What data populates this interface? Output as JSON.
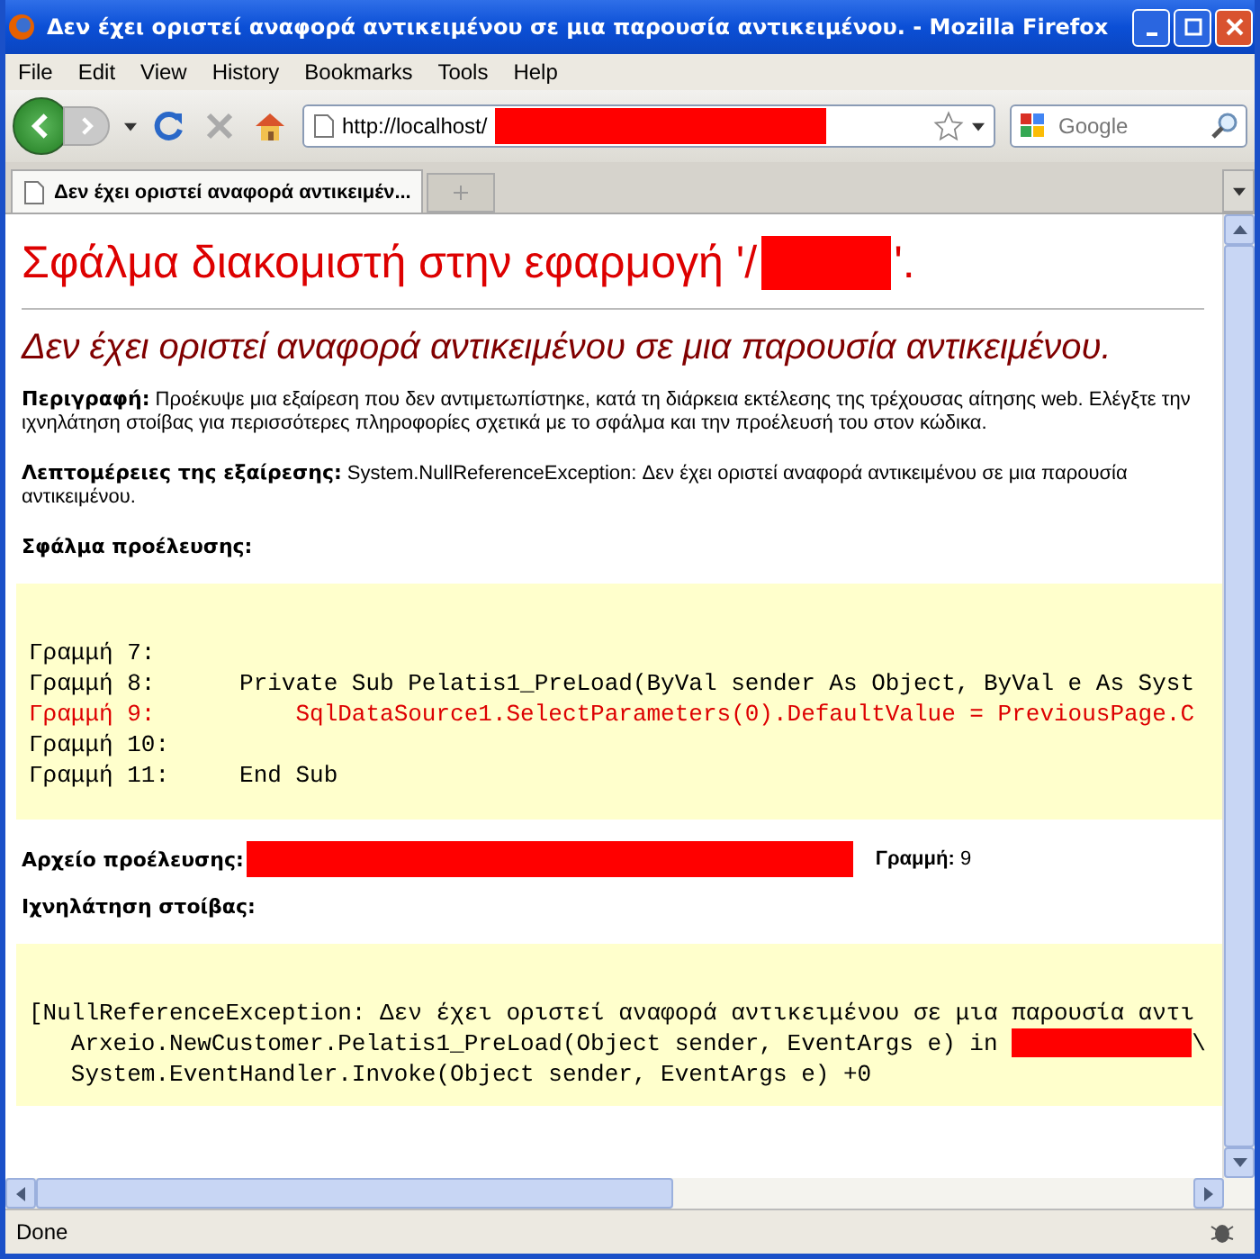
{
  "window": {
    "title": "Δεν έχει οριστεί αναφορά αντικειμένου σε μια παρουσία αντικειμένου. - Mozilla Firefox"
  },
  "menu": [
    "File",
    "Edit",
    "View",
    "History",
    "Bookmarks",
    "Tools",
    "Help"
  ],
  "toolbar": {
    "url": "http://localhost/",
    "search_placeholder": "Google"
  },
  "tabs": [
    {
      "label": "Δεν έχει οριστεί αναφορά αντικειμέν...",
      "selected": true
    }
  ],
  "page": {
    "heading_prefix": "Σφάλμα διακομιστή στην εφαρμογή '/",
    "heading_suffix": "'.",
    "subheading": "Δεν έχει οριστεί αναφορά αντικειμένου σε μια παρουσία αντικειμένου.",
    "description": {
      "label": "Περιγραφή:",
      "text": "Προέκυψε μια εξαίρεση που δεν αντιμετωπίστηκε, κατά τη διάρκεια εκτέλεσης της τρέχουσας αίτησης web. Ελέγξτε την ιχνηλάτηση στοίβας για περισσότερες πληροφορίες σχετικά με το σφάλμα και την προέλευσή του στον κώδικα."
    },
    "exception_details": {
      "label": "Λεπτομέρειες της εξαίρεσης:",
      "text": "System.NullReferenceException: Δεν έχει οριστεί αναφορά αντικειμένου σε μια παρουσία αντικειμένου."
    },
    "source_error_label": "Σφάλμα προέλευσης:",
    "source_lines": [
      {
        "text": "Γραμμή 7:",
        "highlighted": false
      },
      {
        "text": "Γραμμή 8:      Private Sub Pelatis1_PreLoad(ByVal sender As Object, ByVal e As Syst",
        "highlighted": false
      },
      {
        "text": "Γραμμή 9:          SqlDataSource1.SelectParameters(0).DefaultValue = PreviousPage.C",
        "highlighted": true
      },
      {
        "text": "Γραμμή 10:",
        "highlighted": false
      },
      {
        "text": "Γραμμή 11:     End Sub",
        "highlighted": false
      }
    ],
    "source_file": {
      "label": "Αρχείο προέλευσης:",
      "line_label": "Γραμμή:",
      "line_value": "9"
    },
    "stack_trace_label": "Ιχνηλάτηση στοίβας:",
    "stack_lines": [
      {
        "text": "[NullReferenceException: Δεν έχει οριστεί αναφορά αντικειμένου σε μια παρουσία αντι",
        "redacted": false
      },
      {
        "text": "   Arxeio.NewCustomer.Pelatis1_PreLoad(Object sender, EventArgs e) in ",
        "redacted": true,
        "after": "\\"
      },
      {
        "text": "   System.EventHandler.Invoke(Object sender, EventArgs e) +0",
        "redacted": false
      }
    ]
  },
  "status_bar": {
    "text": "Done"
  }
}
